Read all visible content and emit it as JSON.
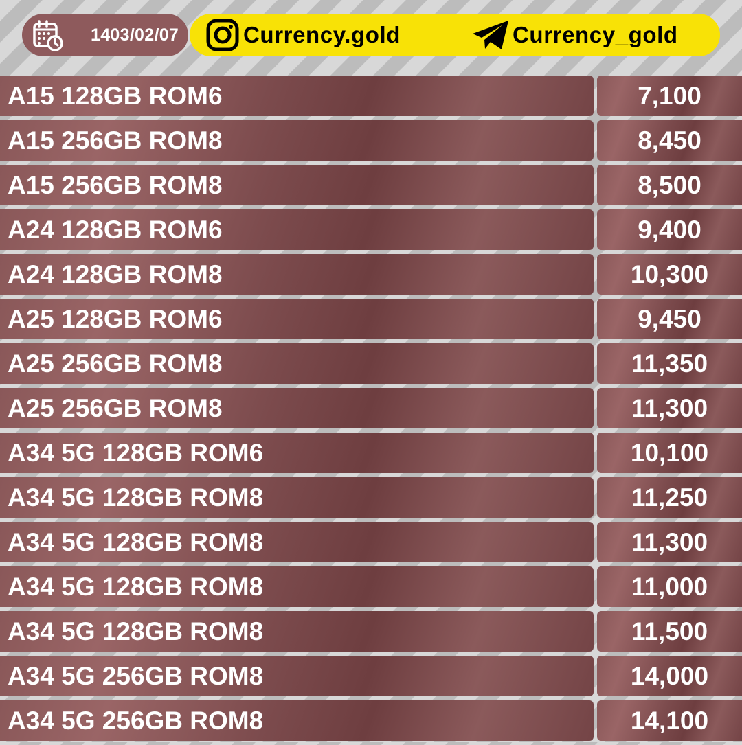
{
  "header": {
    "date": "1403/02/07",
    "instagram_handle": "Currency.gold",
    "telegram_handle": "Currency_gold",
    "date_pill_color": "#8e5a5c",
    "social_pill_color": "#f8e206"
  },
  "icons": {
    "date": "calendar-clock-icon",
    "instagram": "instagram-icon",
    "telegram": "telegram-icon"
  },
  "rows": [
    {
      "name": "A15 128GB ROM6",
      "price": "7,100"
    },
    {
      "name": "A15 256GB ROM8",
      "price": "8,450"
    },
    {
      "name": "A15 256GB ROM8",
      "price": "8,500"
    },
    {
      "name": "A24 128GB ROM6",
      "price": "9,400"
    },
    {
      "name": "A24 128GB ROM8",
      "price": "10,300"
    },
    {
      "name": "A25 128GB ROM6",
      "price": "9,450"
    },
    {
      "name": "A25 256GB ROM8",
      "price": "11,350"
    },
    {
      "name": "A25 256GB ROM8",
      "price": "11,300"
    },
    {
      "name": "A34 5G 128GB ROM6",
      "price": "10,100"
    },
    {
      "name": "A34 5G 128GB ROM8",
      "price": "11,250"
    },
    {
      "name": "A34 5G 128GB ROM8",
      "price": "11,300"
    },
    {
      "name": "A34 5G 128GB ROM8",
      "price": "11,000"
    },
    {
      "name": "A34 5G 128GB ROM8",
      "price": "11,500"
    },
    {
      "name": "A34 5G 256GB ROM8",
      "price": "14,000"
    },
    {
      "name": "A34 5G 256GB ROM8",
      "price": "14,100"
    }
  ]
}
